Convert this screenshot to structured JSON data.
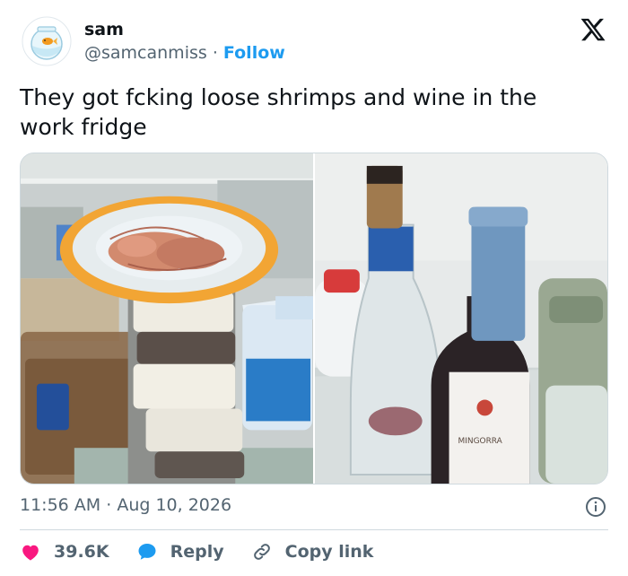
{
  "user": {
    "display_name": "sam",
    "handle": "@samcanmiss",
    "separator": "·",
    "follow_label": "Follow",
    "avatar_icon": "fishbowl-goldfish-icon"
  },
  "brand_icon": "x-logo-icon",
  "tweet": {
    "text": "They got fcking loose shrimps and wine in the work fridge"
  },
  "media": {
    "images": [
      {
        "name": "fridge-shelf-shrimp-photo"
      },
      {
        "name": "fridge-door-wine-photo",
        "visible_text": [
          "MINGORRA"
        ]
      }
    ]
  },
  "meta": {
    "time": "11:56 AM",
    "separator": "·",
    "date": "Aug 10, 2026",
    "info_icon": "info-icon"
  },
  "actions": {
    "like_count": "39.6K",
    "reply_label": "Reply",
    "copy_link_label": "Copy link"
  },
  "colors": {
    "accent": "#1d9bf0",
    "like": "#f91880",
    "text": "#0f1419",
    "muted": "#536471",
    "border": "#cfd9de"
  }
}
